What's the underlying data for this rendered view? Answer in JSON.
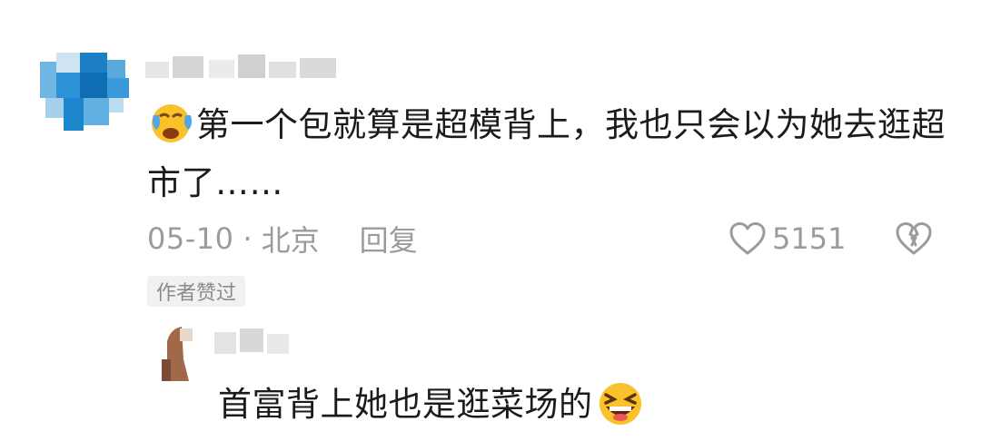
{
  "comment": {
    "text": "第一个包就算是超模背上，我也只会以为她去逛超市了……",
    "emoji": "crying-face-emoji",
    "date": "05-10",
    "separator": "·",
    "location": "北京",
    "reply_label": "回复",
    "like_count": "5151",
    "author_liked_badge": "作者赞过"
  },
  "reply": {
    "text": "首富背上她也是逛菜场的",
    "emoji": "laughing-face-emoji"
  },
  "colors": {
    "text": "#1b1b1b",
    "meta": "#9b9b9b",
    "badge_bg": "#f1f1f1",
    "avatar_blue": "#1a8fd6"
  }
}
